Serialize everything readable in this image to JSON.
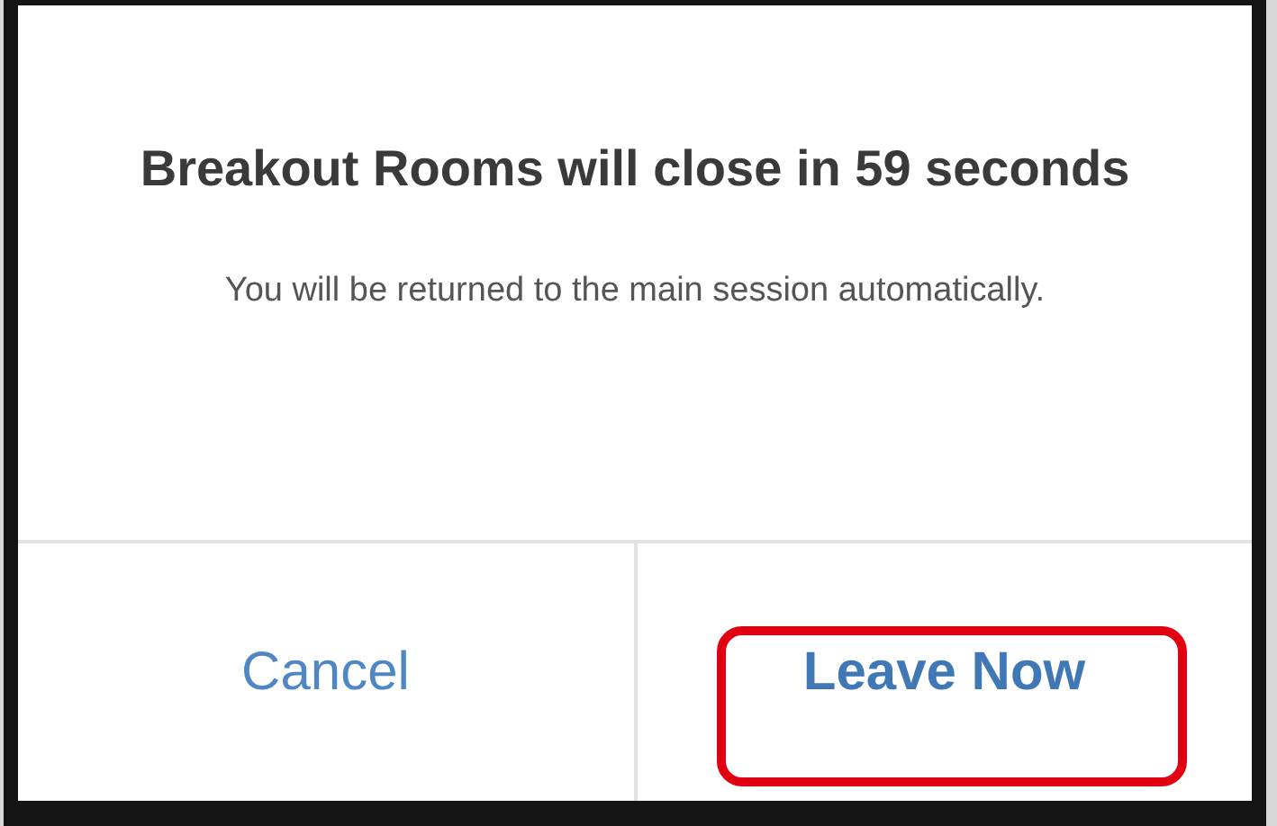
{
  "dialog": {
    "title": "Breakout Rooms will close in 59 seconds",
    "message": "You will be returned to the main session automatically."
  },
  "buttons": [
    {
      "label": "Cancel",
      "kind": "plain",
      "highlighted": false
    },
    {
      "label": "Leave Now",
      "kind": "primary",
      "highlighted": true
    }
  ]
}
